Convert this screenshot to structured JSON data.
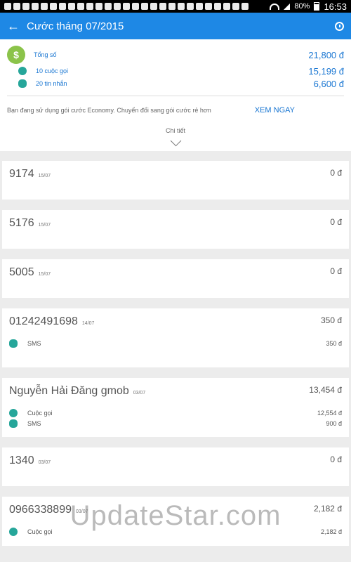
{
  "status": {
    "battery": "80%",
    "time": "16:53"
  },
  "app_bar": {
    "title": "Cước tháng 07/2015"
  },
  "summary": {
    "total_label": "Tổng số",
    "total_value": "21,800 đ",
    "calls_label": "10 cuộc gọi",
    "calls_value": "15,199 đ",
    "sms_label": "20 tin nhắn",
    "sms_value": "6,600 đ",
    "promo_text": "Bạn đang sử dụng gói cước Economy. Chuyển đổi sang gói cước rẻ hơn",
    "promo_button": "XEM NGAY",
    "detail_label": "Chi tiết"
  },
  "records": [
    {
      "name": "9174",
      "date": "15/07",
      "amount": "0 đ",
      "items": []
    },
    {
      "name": "5176",
      "date": "15/07",
      "amount": "0 đ",
      "items": []
    },
    {
      "name": "5005",
      "date": "15/07",
      "amount": "0 đ",
      "items": []
    },
    {
      "name": "01242491698",
      "date": "14/07",
      "amount": "350 đ",
      "items": [
        {
          "icon": "message-icon",
          "label": "SMS",
          "value": "350 đ"
        }
      ]
    },
    {
      "name": "Nguyễn Hải Đăng gmob",
      "date": "03/07",
      "amount": "13,454 đ",
      "items": [
        {
          "icon": "phone-icon",
          "label": "Cuộc gọi",
          "value": "12,554 đ"
        },
        {
          "icon": "message-icon",
          "label": "SMS",
          "value": "900 đ"
        }
      ]
    },
    {
      "name": "1340",
      "date": "03/07",
      "amount": "0 đ",
      "items": []
    },
    {
      "name": "0966338899",
      "date": "03/07",
      "amount": "2,182 đ",
      "items": [
        {
          "icon": "phone-icon",
          "label": "Cuộc gọi",
          "value": "2,182 đ"
        }
      ]
    }
  ],
  "watermark": "UpdateStar.com"
}
